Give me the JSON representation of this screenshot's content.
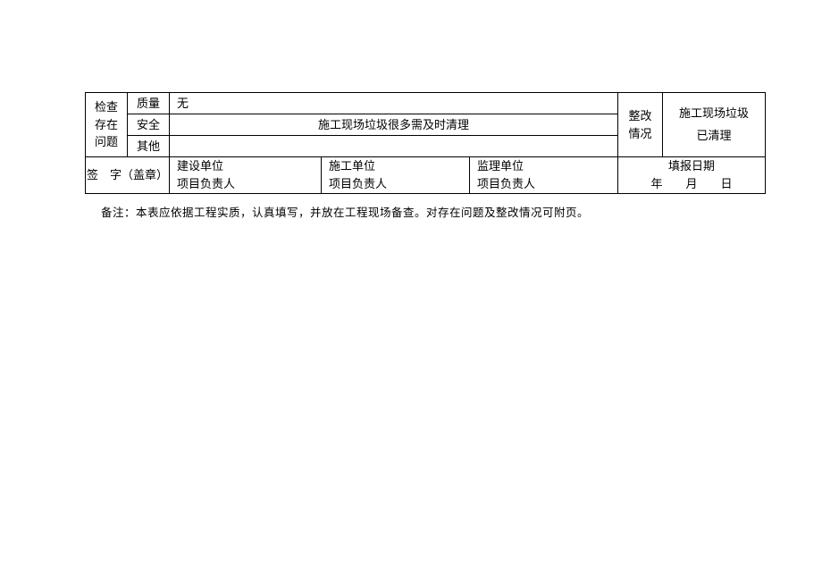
{
  "issues": {
    "header": "检查\n存在\n问题",
    "rows": {
      "quality": {
        "label": "质量",
        "value": "无"
      },
      "safety": {
        "label": "安全",
        "value": "施工现场垃圾很多需及时清理"
      },
      "other": {
        "label": "其他",
        "value": ""
      }
    }
  },
  "rectify": {
    "header": "整改\n情况",
    "value_line1": "施工现场垃圾",
    "value_line2": "已清理"
  },
  "signature": {
    "label": "签　字（盖章）",
    "construction_unit": {
      "line1": "建设单位",
      "line2": "项目负责人"
    },
    "contractor_unit": {
      "line1": "施工单位",
      "line2": "项目负责人"
    },
    "supervision_unit": {
      "line1": "监理单位",
      "line2": "项目负责人"
    }
  },
  "report_date": {
    "label": "填报日期",
    "date_fmt": "年　　月　　日"
  },
  "footnote": "备注：本表应依据工程实质，认真填写，并放在工程现场备查。对存在问题及整改情况可附页。"
}
